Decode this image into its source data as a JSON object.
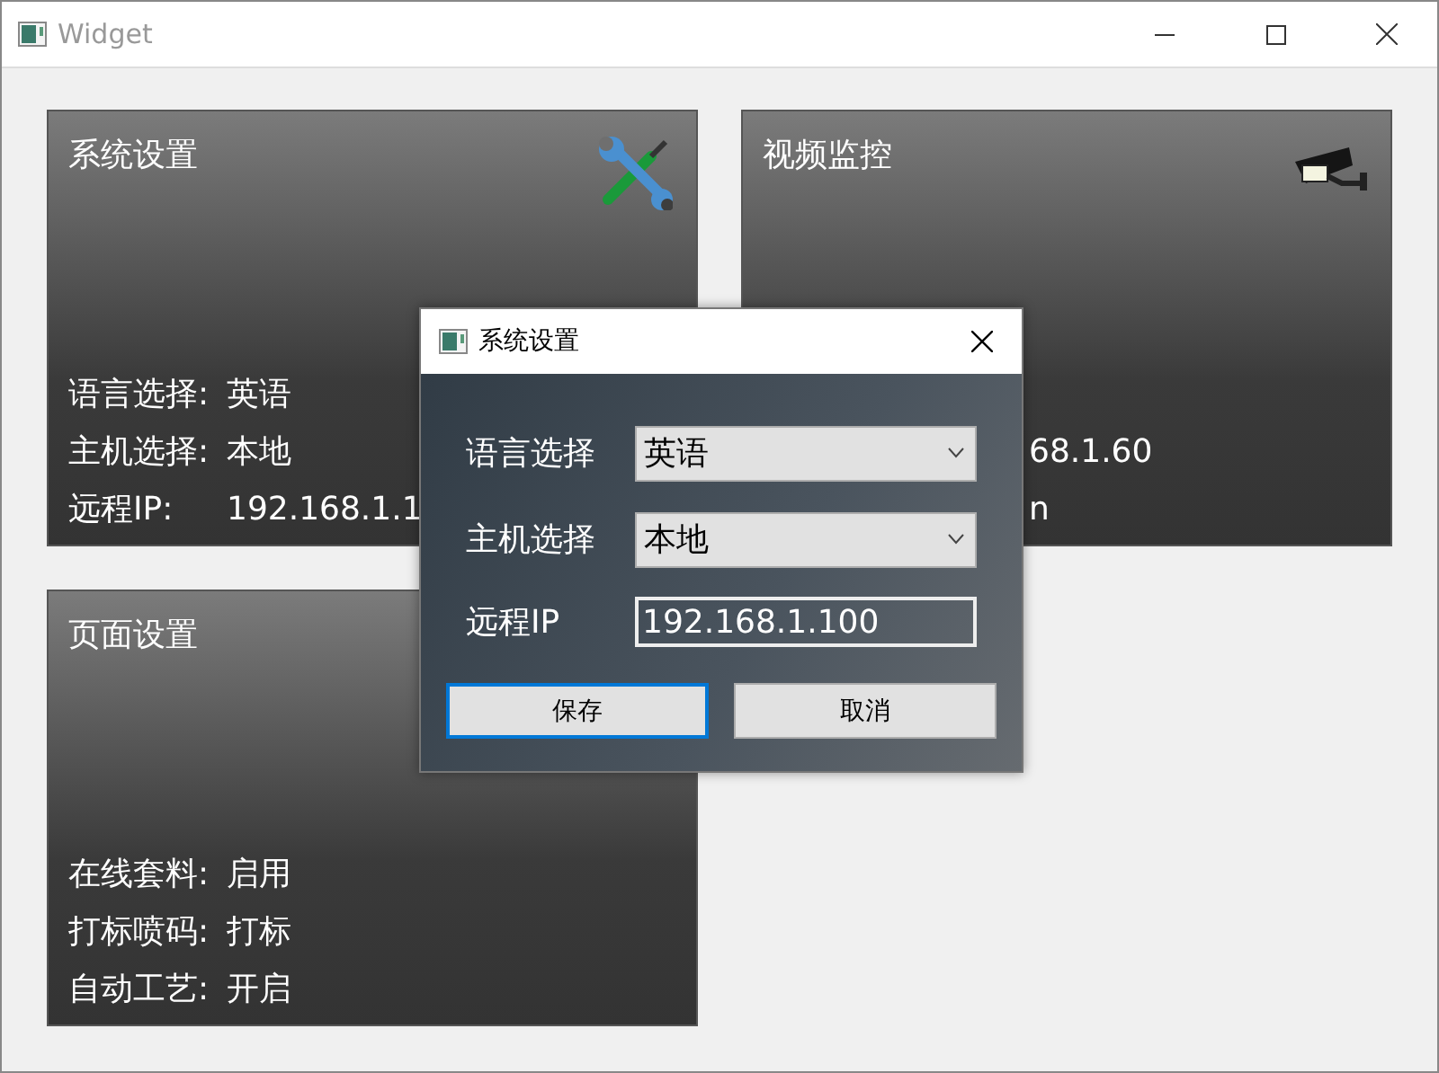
{
  "window": {
    "title": "Widget"
  },
  "cards": [
    {
      "kind": "settings",
      "title": "系统设置",
      "rows": [
        {
          "label": "语言选择:",
          "value": "英语"
        },
        {
          "label": "主机选择:",
          "value": "本地"
        },
        {
          "label": "远程IP:",
          "value": "192.168.1.1"
        }
      ]
    },
    {
      "kind": "camera",
      "title": "视频监控",
      "rows": [
        {
          "value": "68.1.60"
        },
        {
          "value": "n"
        }
      ]
    },
    {
      "kind": "page",
      "title": "页面设置",
      "rows": [
        {
          "label": "在线套料:",
          "value": "启用"
        },
        {
          "label": "打标喷码:",
          "value": "打标"
        },
        {
          "label": "自动工艺:",
          "value": "开启"
        }
      ]
    }
  ],
  "dialog": {
    "title": "系统设置",
    "fields": [
      {
        "kind": "combo",
        "label": "语言选择",
        "value": "英语"
      },
      {
        "kind": "combo",
        "label": "主机选择",
        "value": "本地"
      },
      {
        "kind": "text",
        "label": "远程IP",
        "value": "192.168.1.100"
      }
    ],
    "buttons": [
      {
        "label": "保存",
        "focused": true
      },
      {
        "label": "取消",
        "focused": false
      }
    ]
  }
}
